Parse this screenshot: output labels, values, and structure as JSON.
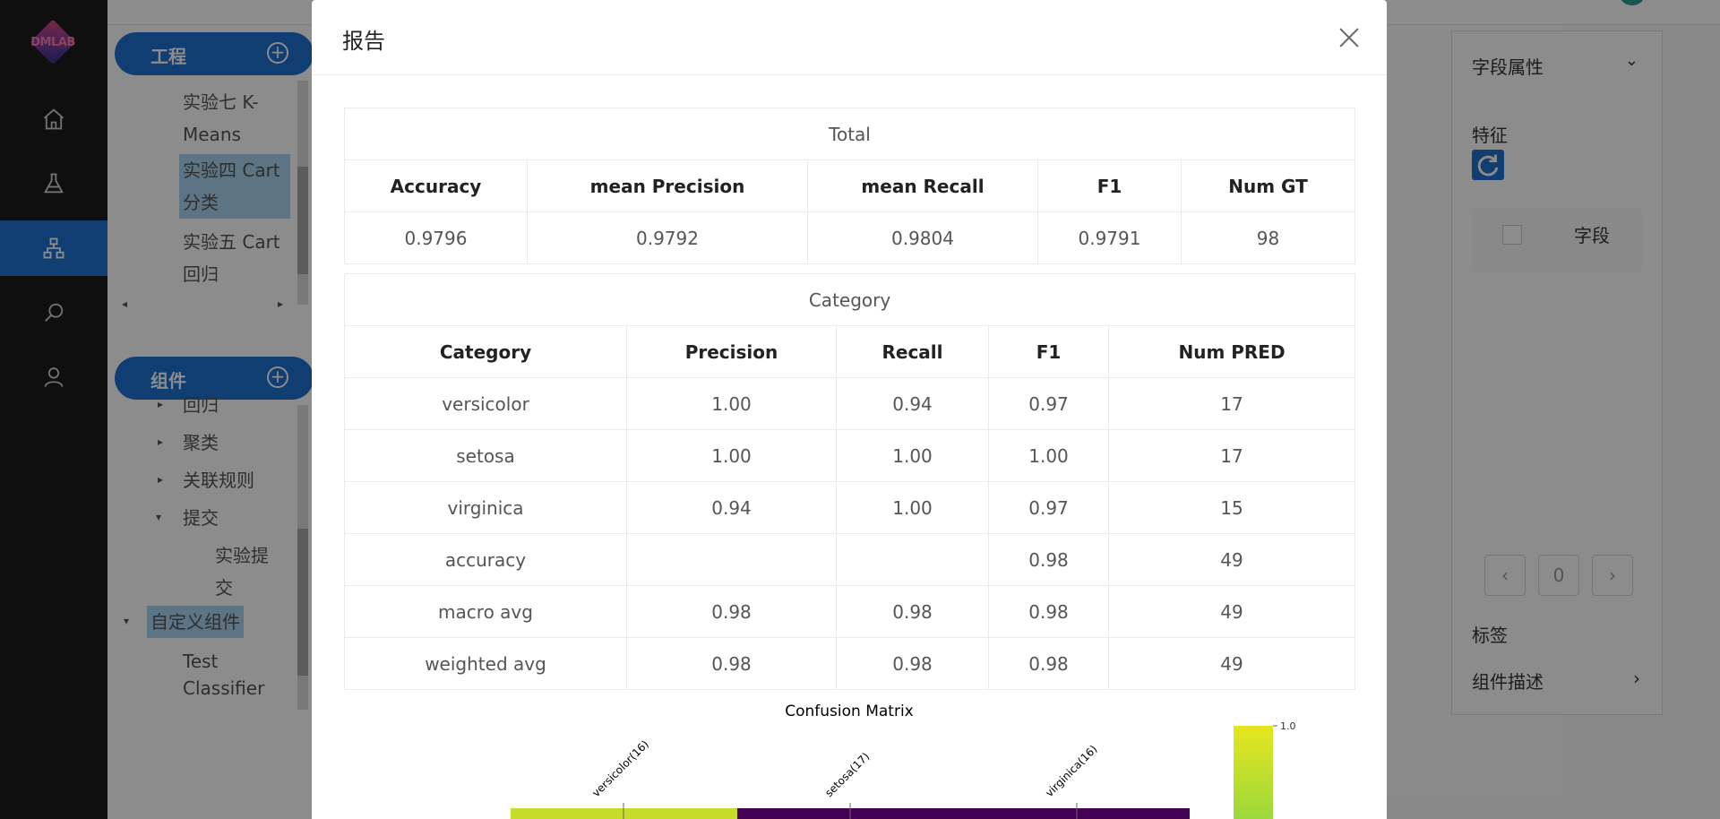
{
  "app": {
    "logo_text": "DMLAB",
    "nav": [
      {
        "name": "home-icon"
      },
      {
        "name": "flask-icon"
      },
      {
        "name": "workflow-icon"
      },
      {
        "name": "search-icon"
      },
      {
        "name": "user-icon"
      }
    ],
    "project_panel": {
      "title": "工程",
      "items": [
        "实验七 K-",
        "Means",
        "实验四 Cart",
        "分类",
        "实验五 Cart",
        "回归"
      ]
    },
    "component_panel": {
      "title": "组件",
      "items": [
        "回归",
        "聚类",
        "关联规则",
        "提交",
        "实验提",
        "交",
        "自定义组件",
        "Test",
        "Classifier"
      ]
    },
    "right_panel": {
      "title": "字段属性",
      "feature_label": "特征",
      "field_header": "字段",
      "page_number": "0",
      "label_section": "标签",
      "description_section": "组件描述"
    }
  },
  "modal": {
    "title": "报告",
    "total_table": {
      "caption": "Total",
      "headers": [
        "Accuracy",
        "mean Precision",
        "mean Recall",
        "F1",
        "Num GT"
      ],
      "values": [
        "0.9796",
        "0.9792",
        "0.9804",
        "0.9791",
        "98"
      ]
    },
    "category_table": {
      "caption": "Category",
      "headers": [
        "Category",
        "Precision",
        "Recall",
        "F1",
        "Num PRED"
      ],
      "rows": [
        [
          "versicolor",
          "1.00",
          "0.94",
          "0.97",
          "17"
        ],
        [
          "setosa",
          "1.00",
          "1.00",
          "1.00",
          "17"
        ],
        [
          "virginica",
          "0.94",
          "1.00",
          "0.97",
          "15"
        ],
        [
          "accuracy",
          "",
          "",
          "0.98",
          "49"
        ],
        [
          "macro avg",
          "0.98",
          "0.98",
          "0.98",
          "49"
        ],
        [
          "weighted avg",
          "0.98",
          "0.98",
          "0.98",
          "49"
        ]
      ]
    },
    "confusion_matrix": {
      "title": "Confusion Matrix",
      "column_labels": [
        "versicolor(16)",
        "setosa(17)",
        "virginica(16)"
      ],
      "colorbar_max_label": "1.0",
      "first_row_colors": [
        "#c5dd2a",
        "#440154",
        "#440154"
      ]
    }
  }
}
